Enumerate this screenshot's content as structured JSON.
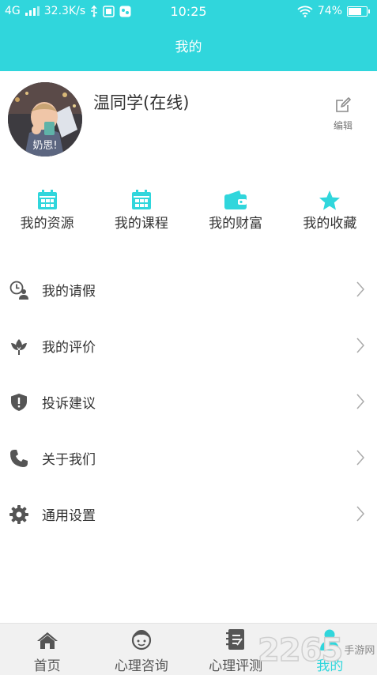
{
  "status_bar": {
    "network": "4G",
    "speed": "32.3K/s",
    "time": "10:25",
    "battery_text": "74%",
    "battery_level": 0.74
  },
  "header": {
    "title": "我的"
  },
  "profile": {
    "name": "温同学(在线)",
    "avatar_caption": "奶思!",
    "edit_label": "编辑"
  },
  "quick_links": [
    {
      "label": "我的资源",
      "icon": "calendar-icon"
    },
    {
      "label": "我的课程",
      "icon": "calendar-icon"
    },
    {
      "label": "我的财富",
      "icon": "wallet-icon"
    },
    {
      "label": "我的收藏",
      "icon": "star-icon"
    }
  ],
  "menu": [
    {
      "label": "我的请假",
      "icon": "clock-user-icon"
    },
    {
      "label": "我的评价",
      "icon": "flower-icon"
    },
    {
      "label": "投诉建议",
      "icon": "shield-alert-icon"
    },
    {
      "label": "关于我们",
      "icon": "phone-icon"
    },
    {
      "label": "通用设置",
      "icon": "gear-icon"
    }
  ],
  "tabbar": [
    {
      "label": "首页",
      "icon": "home-icon",
      "active": false
    },
    {
      "label": "心理咨询",
      "icon": "face-icon",
      "active": false
    },
    {
      "label": "心理评测",
      "icon": "notebook-icon",
      "active": false
    },
    {
      "label": "我的",
      "icon": "person-icon",
      "active": true
    }
  ],
  "watermark": {
    "number": "2265",
    "site": "手游网"
  },
  "colors": {
    "accent": "#30d6dc",
    "text": "#333333",
    "icon_gray": "#555555",
    "tabbar_bg": "#f1f1f1"
  }
}
